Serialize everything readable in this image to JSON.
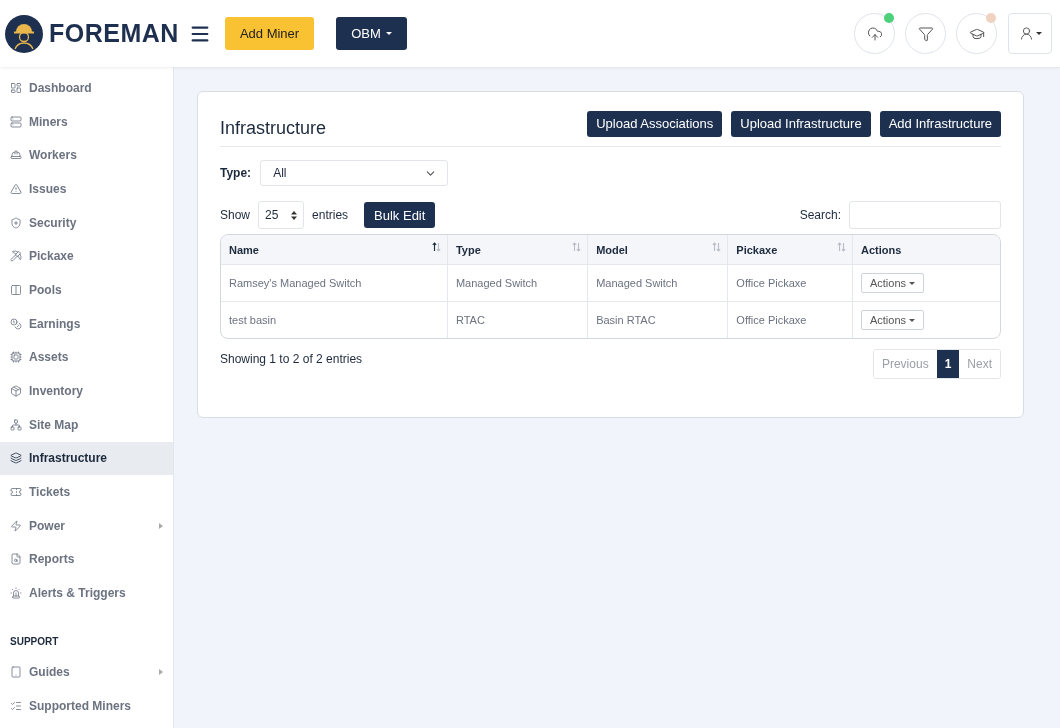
{
  "header": {
    "brand": "FOREMAN",
    "add_button": "Add Miner",
    "org_button": "OBM",
    "icon_buttons": [
      {
        "badge": true,
        "color": "#4cd07a"
      },
      {
        "badge": false
      },
      {
        "badge": true,
        "color": "#f0d2c0"
      }
    ]
  },
  "sidebar": {
    "items": [
      {
        "label": "Dashboard",
        "selected": false,
        "expandable": false
      },
      {
        "label": "Miners",
        "selected": false,
        "expandable": false
      },
      {
        "label": "Workers",
        "selected": false,
        "expandable": false
      },
      {
        "label": "Issues",
        "selected": false,
        "expandable": false
      },
      {
        "label": "Security",
        "selected": false,
        "expandable": false
      },
      {
        "label": "Pickaxe",
        "selected": false,
        "expandable": false
      },
      {
        "label": "Pools",
        "selected": false,
        "expandable": false
      },
      {
        "label": "Earnings",
        "selected": false,
        "expandable": false
      },
      {
        "label": "Assets",
        "selected": false,
        "expandable": false
      },
      {
        "label": "Inventory",
        "selected": false,
        "expandable": false
      },
      {
        "label": "Site Map",
        "selected": false,
        "expandable": false
      },
      {
        "label": "Infrastructure",
        "selected": true,
        "expandable": false
      },
      {
        "label": "Tickets",
        "selected": false,
        "expandable": false
      },
      {
        "label": "Power",
        "selected": false,
        "expandable": true
      },
      {
        "label": "Reports",
        "selected": false,
        "expandable": false
      },
      {
        "label": "Alerts & Triggers",
        "selected": false,
        "expandable": false
      }
    ],
    "section_title": "SUPPORT",
    "support_items": [
      {
        "label": "Guides",
        "selected": false,
        "expandable": true
      },
      {
        "label": "Supported Miners",
        "selected": false,
        "expandable": false
      }
    ]
  },
  "card": {
    "title": "Infrastructure",
    "buttons": [
      "Upload Associations",
      "Upload Infrastructure",
      "Add Infrastructure"
    ],
    "type_filter": {
      "label": "Type:",
      "value": "All"
    },
    "length": {
      "before": "Show",
      "value": "25",
      "after": "entries"
    },
    "bulk_button": "Bulk Edit",
    "search": {
      "label": "Search:"
    },
    "table": {
      "columns": [
        {
          "label": "Name",
          "sortable": true,
          "sorted": true
        },
        {
          "label": "Type",
          "sortable": true,
          "sorted": false
        },
        {
          "label": "Model",
          "sortable": true,
          "sorted": false
        },
        {
          "label": "Pickaxe",
          "sortable": true,
          "sorted": false
        },
        {
          "label": "Actions",
          "sortable": false
        }
      ],
      "rows": [
        {
          "cells": [
            "Ramsey's Managed Switch",
            "Managed Switch",
            "Managed Switch",
            "Office Pickaxe"
          ],
          "action": "Actions"
        },
        {
          "cells": [
            "test basin",
            "RTAC",
            "Basin RTAC",
            "Office Pickaxe"
          ],
          "action": "Actions"
        }
      ]
    },
    "info": "Showing 1 to 2 of 2 entries",
    "pagination": [
      {
        "label": "Previous",
        "selected": false,
        "disabled": true
      },
      {
        "label": "1",
        "selected": true,
        "disabled": false
      },
      {
        "label": "Next",
        "selected": false,
        "disabled": true
      }
    ]
  }
}
